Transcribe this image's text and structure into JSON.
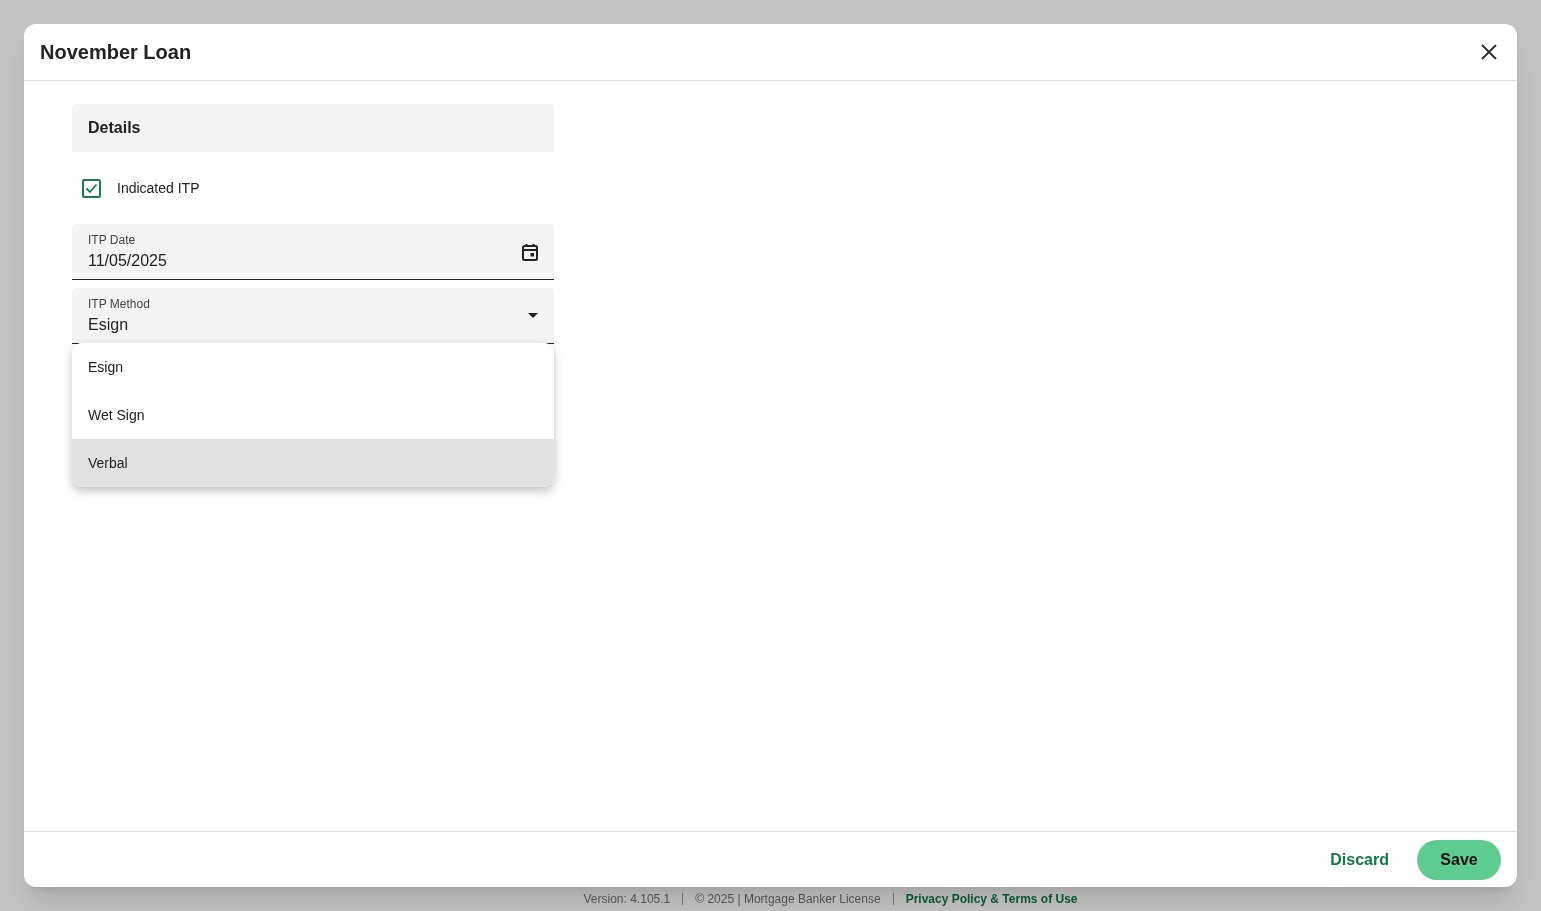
{
  "dialog": {
    "title": "November Loan",
    "section": {
      "title": "Details"
    },
    "checkbox": {
      "label": "Indicated ITP",
      "checked": true
    },
    "date_field": {
      "label": "ITP Date",
      "value": "11/05/2025"
    },
    "select_field": {
      "label": "ITP Method",
      "value": "Esign",
      "expanded": true
    },
    "options": [
      {
        "label": "Esign",
        "highlighted": false
      },
      {
        "label": "Wet Sign",
        "highlighted": false
      },
      {
        "label": "Verbal",
        "highlighted": true
      }
    ],
    "buttons": {
      "discard": "Discard",
      "save": "Save"
    }
  },
  "page_footer": {
    "version": "Version: 4.105.1",
    "license": "© 2025 | Mortgage Banker License",
    "link": "Privacy Policy & Terms of Use"
  }
}
